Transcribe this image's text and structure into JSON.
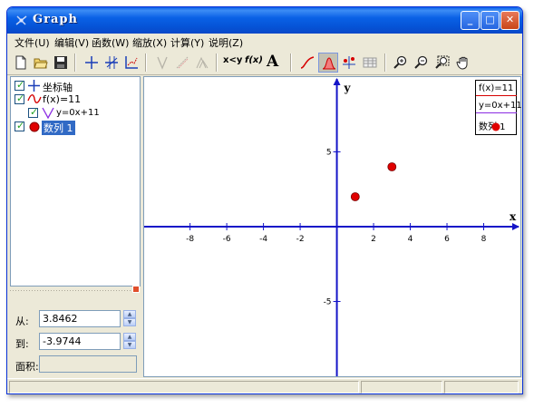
{
  "window": {
    "title": "Graph",
    "buttons": {
      "minimize": "_",
      "maximize": "□",
      "close": "✕"
    }
  },
  "menu": {
    "items": [
      "文件(U)",
      "编辑(V)",
      "函数(W)",
      "缩放(X)",
      "计算(Y)",
      "说明(Z)"
    ]
  },
  "toolbar": {
    "xy_label": "x<y",
    "fx_label": "f(x)",
    "text_label": "A"
  },
  "tree": {
    "items": [
      {
        "label": "坐标轴",
        "icon": "axes-icon"
      },
      {
        "label": "f(x)=11",
        "icon": "function-curve-icon"
      },
      {
        "label": "y=0x+11",
        "icon": "tangent-icon"
      },
      {
        "label": "数列 1",
        "icon": "point-series-icon",
        "selected": true
      }
    ]
  },
  "fields": {
    "from_label": "从:",
    "from_value": "3.8462",
    "to_label": "到:",
    "to_value": "-3.9744",
    "area_label": "面积:",
    "area_value": ""
  },
  "legend": {
    "items": [
      "f(x)=11",
      "y=0x+11",
      "数列 1"
    ]
  },
  "chart_data": {
    "type": "scatter",
    "xlabel": "x",
    "ylabel": "y",
    "xlim": [
      -10.5,
      10
    ],
    "ylim": [
      -10,
      10
    ],
    "x_ticks": [
      -8,
      -6,
      -4,
      -2,
      2,
      4,
      6,
      8
    ],
    "y_ticks": [
      5,
      -5
    ],
    "series": [
      {
        "name": "数列 1",
        "points": [
          [
            1,
            2
          ],
          [
            3,
            4
          ]
        ],
        "color": "#e00000"
      }
    ],
    "axis_color": "#1414c8"
  },
  "colors": {
    "title_bar": "#0a5ee8",
    "selection": "#316ac5",
    "point": "#e00000"
  }
}
